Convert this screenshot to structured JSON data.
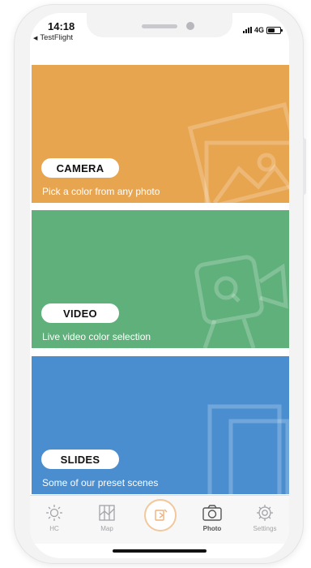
{
  "status": {
    "time": "14:18",
    "back_app": "TestFlight",
    "network": "4G"
  },
  "cards": [
    {
      "title": "CAMERA",
      "subtitle": "Pick a color from any photo",
      "color": "#e8a54f"
    },
    {
      "title": "VIDEO",
      "subtitle": "Live video color selection",
      "color": "#5fb07a"
    },
    {
      "title": "SLIDES",
      "subtitle": "Some of our preset scenes",
      "color": "#4a8ed0"
    }
  ],
  "tabbar": {
    "tabs": [
      {
        "label": "HC",
        "icon": "sun-icon"
      },
      {
        "label": "Map",
        "icon": "map-icon"
      },
      {
        "label": "",
        "icon": "color-picker-icon"
      },
      {
        "label": "Photo",
        "icon": "camera-icon",
        "active": true
      },
      {
        "label": "Settings",
        "icon": "gear-icon"
      }
    ],
    "accent": "#f0b27a"
  }
}
